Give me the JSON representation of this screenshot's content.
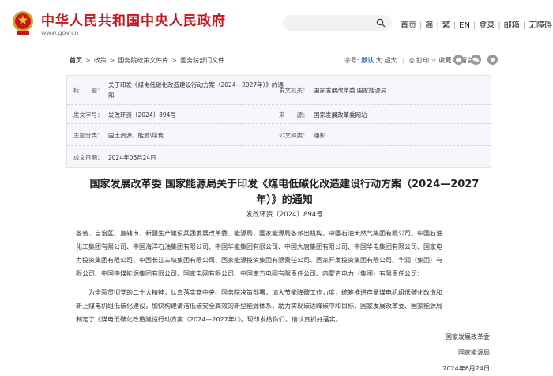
{
  "header": {
    "title": "中华人民共和国中央人民政府",
    "domain": "www.gov.cn",
    "nav": [
      "首页",
      "简",
      "繁",
      "EN",
      "登录",
      "邮箱",
      "无障碍"
    ]
  },
  "breadcrumb": {
    "items": [
      "首页",
      "政策",
      "国务院政策文件库",
      "国务院部门文件"
    ],
    "font_label": "字号:",
    "font_sizes": [
      "默认",
      "大",
      "超大"
    ],
    "print": "打印",
    "favorite": "收藏",
    "comment": "留言"
  },
  "meta": {
    "title_label": "标　　题：",
    "title_value_1": "关于印发《煤电低碳化改造建设行动方案（2024—2027年）》的通",
    "title_value_2": "知",
    "issuer_label": "发文机关：",
    "issuer_value": "国家发展改革委 国家能源局",
    "docno_label": "发文字号：",
    "docno_value": "发改环资〔2024〕894号",
    "source_label": "来　　源：",
    "source_value": "国家发展改革委网站",
    "topic_label": "主题分类：",
    "topic_value": "国土资源、能源\\煤炭",
    "type_label": "公文种类：",
    "type_value": "通知",
    "date_label": "成文日期：",
    "date_value": "2024年06月24日"
  },
  "document": {
    "title_line1": "国家发展改革委 国家能源局关于印发《煤电低碳化改造建设行动方案（2024—2027",
    "title_line2": "年）》的通知",
    "number": "发改环资〔2024〕894号",
    "recipients": [
      "各省、自治区、直辖市、新疆生产建设兵团发展改革委、能源局，国家能源局各派出机构，中国石油天然气集团有限公司、中国石油",
      "化工集团有限公司、中国海洋石油集团有限公司、中国华能集团有限公司、中国大唐集团有限公司、中国华电集团有限公司、国家电",
      "力投资集团有限公司、中国长江三峡集团有限公司、国家能源投资集团有限责任公司、国家开发投资集团有限公司、华润（集团）有",
      "限公司、中国中煤能源集团有限公司、国家电网有限公司、中国南方电网有限责任公司、内蒙古电力（集团）有限责任公司："
    ],
    "body": [
      "　　为全面贯彻党的二十大精神，认真落实党中央、国务院决策部署，加大节能降碳工作力度，统筹推进存量煤电机组低碳化改造和",
      "新上煤电机组低碳化建设，加快构建清洁低碳安全高效的新型能源体系，助力实现碳达峰碳中和目标，国家发展改革委、国家能源局",
      "制定了《煤电低碳化改造建设行动方案（2024—2027年）》。现印发给你们，请认真抓好落实。"
    ],
    "sign_1": "国家发展改革委",
    "sign_2": "国家能源局",
    "sign_date": "2024年6月24日"
  },
  "colors": {
    "brand_red": "#c7161e",
    "accent_blue": "#2a6ec6"
  }
}
